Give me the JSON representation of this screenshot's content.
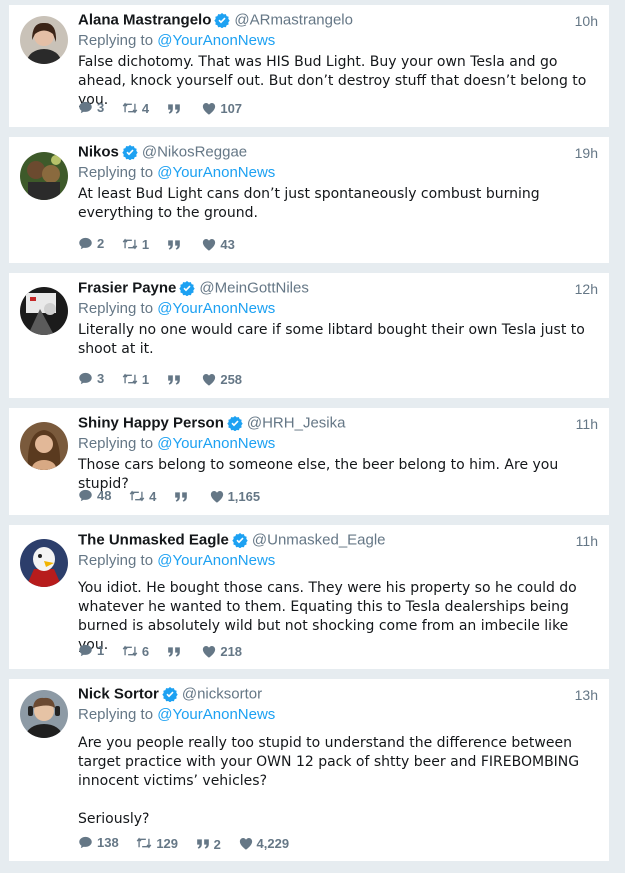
{
  "colors": {
    "background": "#e6ecf0",
    "card": "#ffffff",
    "link": "#1da1f2",
    "muted": "#657786",
    "text": "#14171a",
    "verified": "#1da1f2"
  },
  "icons": [
    "reply-icon",
    "retweet-icon",
    "quote-icon",
    "like-icon",
    "verified-badge-icon"
  ],
  "tweets": [
    {
      "name": "Alana Mastrangelo",
      "handle": "@ARmastrangelo",
      "time": "10h",
      "replying_prefix": "Replying to",
      "replying_to": "@YourAnonNews",
      "text": "False dichotomy. That was HIS Bud Light. Buy your own Tesla and go ahead, knock yourself out. But don’t destroy stuff that doesn’t belong to you.",
      "replies": "3",
      "retweets": "4",
      "quotes": "",
      "likes": "107"
    },
    {
      "name": "Nikos",
      "handle": "@NikosReggae",
      "time": "19h",
      "replying_prefix": "Replying to",
      "replying_to": "@YourAnonNews",
      "text": "At least Bud Light cans don’t just spontaneously combust burning everything to the ground.",
      "replies": "2",
      "retweets": "1",
      "quotes": "",
      "likes": "43"
    },
    {
      "name": "Frasier Payne",
      "handle": "@MeinGottNiles",
      "time": "12h",
      "replying_prefix": "Replying to",
      "replying_to": "@YourAnonNews",
      "text": "Literally no one would care if some libtard bought their own Tesla just to shoot at it.",
      "replies": "3",
      "retweets": "1",
      "quotes": "",
      "likes": "258"
    },
    {
      "name": "Shiny Happy Person",
      "handle": "@HRH_Jesika",
      "time": "11h",
      "replying_prefix": "Replying to",
      "replying_to": "@YourAnonNews",
      "text": "Those cars belong to someone else, the beer belong to him. Are you stupid?",
      "replies": "48",
      "retweets": "4",
      "quotes": "",
      "likes": "1,165"
    },
    {
      "name": "The Unmasked Eagle",
      "handle": "@Unmasked_Eagle",
      "time": "11h",
      "replying_prefix": "Replying to",
      "replying_to": "@YourAnonNews",
      "text": "You idiot. He bought those cans. They were his property so he could do whatever he wanted to them. Equating this to Tesla dealerships being burned is absolutely wild but not shocking come from an imbecile like you.",
      "replies": "1",
      "retweets": "6",
      "quotes": "",
      "likes": "218"
    },
    {
      "name": "Nick Sortor",
      "handle": "@nicksortor",
      "time": "13h",
      "replying_prefix": "Replying to",
      "replying_to": "@YourAnonNews",
      "text": "Are you people really too stupid to understand the difference between target practice with your OWN 12 pack of shtty beer and FIREBOMBING innocent victims’ vehicles?\n\nSeriously?",
      "replies": "138",
      "retweets": "129",
      "quotes": "2",
      "likes": "4,229"
    }
  ]
}
